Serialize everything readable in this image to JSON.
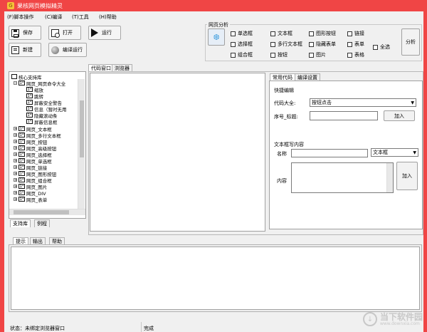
{
  "window": {
    "title": "果核网页模拟精灵",
    "icon": "app-icon"
  },
  "menu": [
    "(F)脚本操作",
    "(C)编译",
    "(T)工具",
    "(H)帮助"
  ],
  "toolbar": {
    "save": "保存",
    "open": "打开",
    "run": "运行",
    "new": "新建",
    "compile_run": "编译运行"
  },
  "analysis": {
    "title": "网页分析",
    "options": [
      "单选框",
      "文本框",
      "图形按钮",
      "链接",
      "选择框",
      "多行文本框",
      "隐藏表单",
      "表单",
      "组合框",
      "按钮",
      "图片",
      "表格"
    ],
    "select_all": "全选",
    "analyze_button": "分析"
  },
  "library": {
    "tabs": [
      "支持库",
      "例程"
    ],
    "root": "核心支持库",
    "commands_group": "网页_网页命令大全",
    "commands": [
      "缩放",
      "跳转",
      "屏蔽安全警告",
      "信息（暂时无用",
      "隐藏滚动条",
      "屏蔽信息框"
    ],
    "groups": [
      "网页_文本框",
      "网页_多行文本框",
      "网页_按钮",
      "网页_高级按钮",
      "网页_选择框",
      "网页_单选框",
      "网页_链接",
      "网页_图形按钮",
      "网页_组合框",
      "网页_图片",
      "网页_DIV",
      "网页_表单"
    ]
  },
  "editor": {
    "tabs": [
      "代码窗口",
      "浏览器"
    ]
  },
  "right_panel": {
    "tabs": [
      "常用代码",
      "编译设置"
    ],
    "quick_section": "快捷编辑",
    "code_label": "代码大全:",
    "code_value": "按钮点击",
    "index_label": "序号_标题:",
    "index_value": "",
    "add": "加入",
    "textbox_section": "文本框写内容",
    "name_label": "名称",
    "name_value": "",
    "type_value": "文本框",
    "content_label": "内容",
    "content_value": "",
    "add2": "加入"
  },
  "bottom": {
    "tabs": [
      "提示",
      "输出",
      "帮助"
    ]
  },
  "status": {
    "left": "状态：未绑定浏览器窗口",
    "right": "完成"
  },
  "watermark": {
    "title": "当下软件园",
    "url": "www.downxia.com"
  }
}
